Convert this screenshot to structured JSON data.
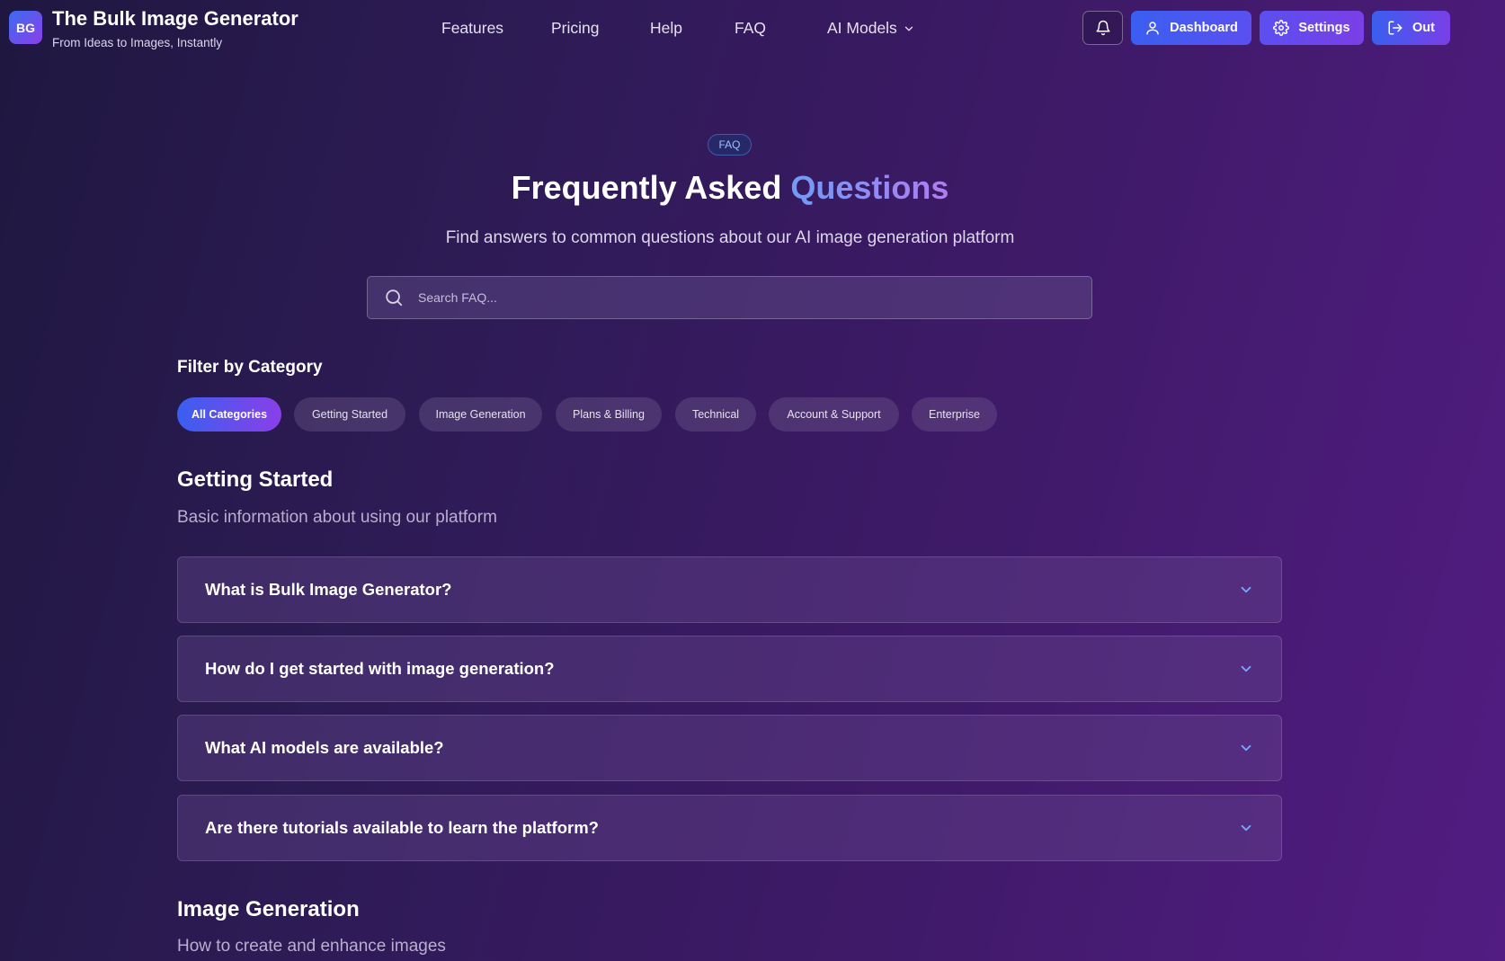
{
  "brand": {
    "badge": "BG",
    "title": "The Bulk Image Generator",
    "subtitle": "From Ideas to Images, Instantly"
  },
  "nav": {
    "features": "Features",
    "pricing": "Pricing",
    "help": "Help",
    "faq": "FAQ",
    "ai_models": "AI Models"
  },
  "header_buttons": {
    "dashboard": "Dashboard",
    "settings": "Settings",
    "out": "Out"
  },
  "hero": {
    "badge": "FAQ",
    "title_main": "Frequently Asked",
    "title_accent": "Questions",
    "subtitle": "Find answers to common questions about our AI image generation platform"
  },
  "search": {
    "placeholder": "Search FAQ..."
  },
  "filter": {
    "title": "Filter by Category",
    "categories": [
      "All Categories",
      "Getting Started",
      "Image Generation",
      "Plans & Billing",
      "Technical",
      "Account & Support",
      "Enterprise"
    ],
    "selected": "All Categories"
  },
  "sections": [
    {
      "title": "Getting Started",
      "subtitle": "Basic information about using our platform",
      "questions": [
        "What is Bulk Image Generator?",
        "How do I get started with image generation?",
        "What AI models are available?",
        "Are there tutorials available to learn the platform?"
      ]
    },
    {
      "title": "Image Generation",
      "subtitle": "How to create and enhance images",
      "questions": []
    }
  ],
  "colors": {
    "accent_blue": "#3a5ff0",
    "accent_purple": "#8a3fe8",
    "chevron": "#7aa8ff",
    "faq_badge_text": "#9cc2ff"
  },
  "icons": {
    "bell": "bell-icon",
    "user": "user-icon",
    "gear": "gear-icon",
    "logout": "logout-icon",
    "search": "search-icon",
    "chevron": "chevron-down-icon"
  }
}
